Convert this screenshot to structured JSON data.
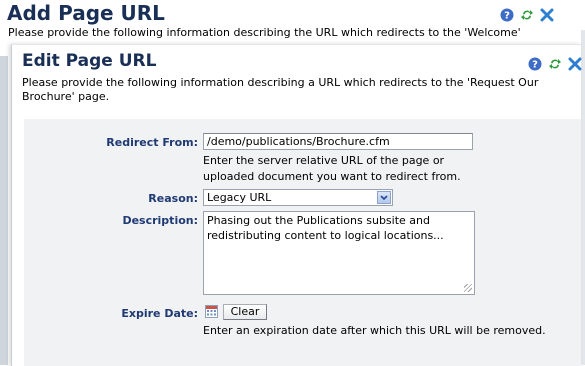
{
  "background_dialog": {
    "title": "Add Page URL",
    "description": "Please provide the following information describing the URL which redirects to the 'Welcome'"
  },
  "dialog": {
    "title": "Edit Page URL",
    "description": "Please provide the following information describing a URL which redirects to the 'Request Our Brochure' page.",
    "icons": [
      "help-icon",
      "refresh-icon",
      "close-icon"
    ]
  },
  "form": {
    "redirect_from": {
      "label": "Redirect From:",
      "value": "/demo/publications/Brochure.cfm",
      "help": "Enter the server relative URL of the page or uploaded document you want to redirect from."
    },
    "reason": {
      "label": "Reason:",
      "selected": "Legacy URL"
    },
    "description": {
      "label": "Description:",
      "value": "Phasing out the Publications subsite and redistributing content to logical locations..."
    },
    "expire_date": {
      "label": "Expire Date:",
      "clear_label": "Clear",
      "help": "Enter an expiration date after which this URL will be removed."
    }
  },
  "colors": {
    "title": "#1a2f55",
    "label": "#1f3a73",
    "content_bg": "#f0f2f4"
  }
}
